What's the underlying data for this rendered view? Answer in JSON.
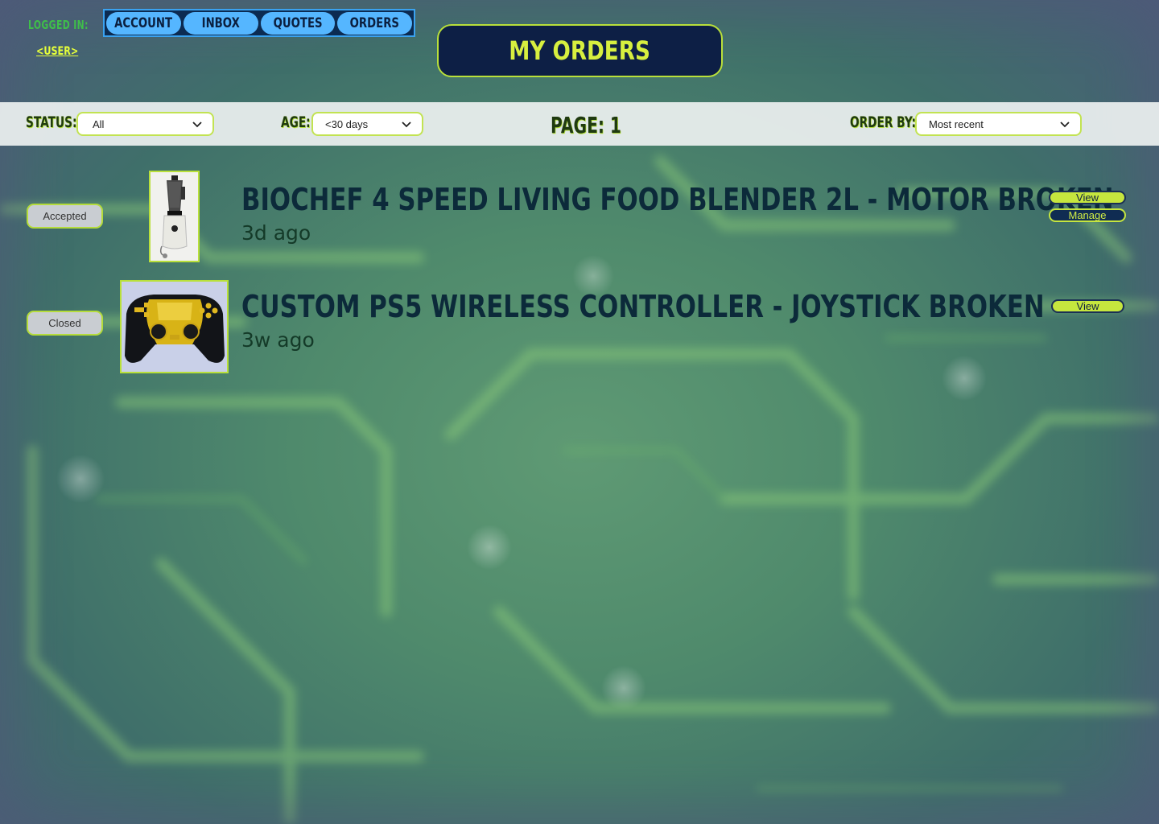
{
  "header": {
    "logged_in_label": "LOGGED IN:",
    "user_link": "<USER>",
    "page_title": "MY ORDERS"
  },
  "nav": {
    "tabs": [
      {
        "label": "ACCOUNT"
      },
      {
        "label": "INBOX"
      },
      {
        "label": "QUOTES"
      },
      {
        "label": "ORDERS"
      }
    ]
  },
  "filters": {
    "status_label": "STATUS:",
    "status_value": "All",
    "age_label": "AGE:",
    "age_value": "<30 days",
    "page_label": "PAGE: 1",
    "order_by_label": "ORDER BY:",
    "order_by_value": "Most recent"
  },
  "orders": [
    {
      "status": "Accepted",
      "title": "BioChef 4 speed living food blender 2L - motor broken",
      "age": "3d ago",
      "image": "blender-image",
      "actions": {
        "view": "View",
        "manage": "Manage"
      }
    },
    {
      "status": "Closed",
      "title": "Custom PS5 Wireless Controller - Joystick Broken",
      "age": "3w ago",
      "image": "controller-image",
      "actions": {
        "view": "View"
      }
    }
  ],
  "colors": {
    "accent_lime": "#c6e63e",
    "navy": "#0d1f45",
    "nav_tab_blue": "#55b6ff",
    "logged_in_green": "#3fbf4a"
  }
}
